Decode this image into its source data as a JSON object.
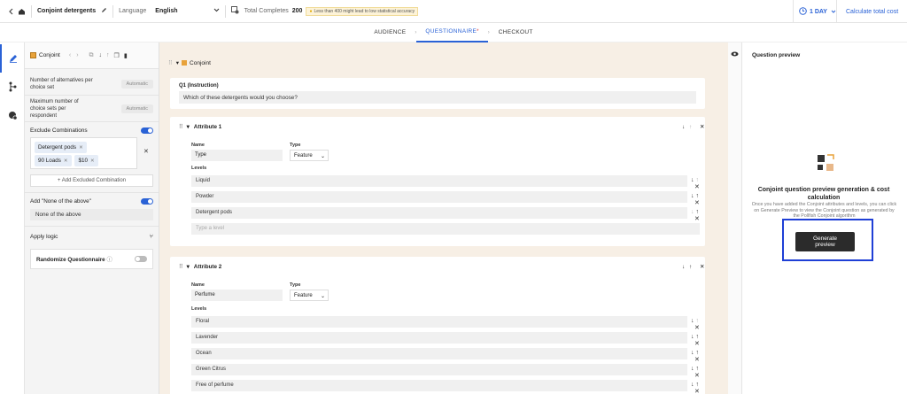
{
  "topbar": {
    "survey_name": "Conjoint detergents",
    "language_label": "Language",
    "language_value": "English",
    "total_label": "Total Completes",
    "total_value": "200",
    "warning": "Less than 400 might lead to low statistical accuracy",
    "duration": "1 DAY",
    "calc_link": "Calculate total cost"
  },
  "tabs": [
    {
      "label": "AUDIENCE"
    },
    {
      "label": "QUESTIONNAIRE",
      "marker": "*"
    },
    {
      "label": "CHECKOUT"
    }
  ],
  "left_panel": {
    "section_label": "Conjoint",
    "alt_per_set_label": "Number of alternatives per choice set",
    "alt_per_set_value": "Automatic",
    "max_sets_label": "Maximum number of choice sets per respondent",
    "max_sets_value": "Automatic",
    "exclude_label": "Exclude Combinations",
    "chips": [
      "Detergent pods",
      "90 Loads",
      "$10"
    ],
    "add_excluded": "+ Add Excluded Combination",
    "none_label": "Add \"None of the above\"",
    "none_value": "None of the above",
    "apply_logic": "Apply logic",
    "randomize": "Randomize Questionnaire"
  },
  "center": {
    "header_label": "Conjoint",
    "q_title": "Q1 (Instruction)",
    "q_text": "Which of these detergents would you choose?",
    "name_label": "Name",
    "type_label": "Type",
    "levels_label": "Levels",
    "attributes": [
      {
        "title": "Attribute 1",
        "name": "Type",
        "type": "Feature",
        "levels": [
          "Liquid",
          "Powder",
          "Detergent pods"
        ],
        "placeholder": "Type a level"
      },
      {
        "title": "Attribute 2",
        "name": "Perfume",
        "type": "Feature",
        "levels": [
          "Floral",
          "Lavender",
          "Ocean",
          "Green Citrus",
          "Free of perfume"
        ]
      }
    ]
  },
  "preview": {
    "title": "Question preview",
    "heading": "Conjoint question preview generation & cost calculation",
    "body": "Once you have added the Conjoint attributes and levels, you can click on Generate Preview to view the Conjoint question as generated by the Pollfish Conjoint algorithm",
    "button": "Generate preview"
  },
  "colors": {
    "accent": "#2a62d6",
    "warning_bg": "#fdf3d8",
    "center_bg": "#f7efe5"
  }
}
